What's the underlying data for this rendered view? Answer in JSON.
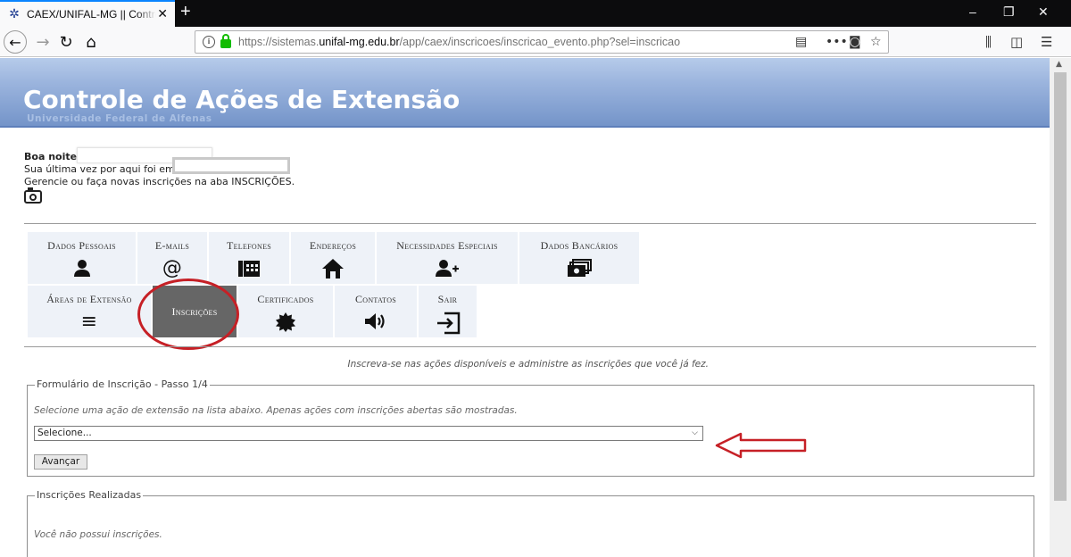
{
  "browser": {
    "tab_title": "CAEX/UNIFAL-MG || Controle de Ações de Extensão",
    "tab_close": "✕",
    "new_tab": "+",
    "url_prefix": "https://sistemas.",
    "url_domain": "unifal-mg.edu.br",
    "url_path": "/app/caex/inscricoes/inscricao_evento.php?sel=inscricao",
    "window_controls": [
      "–",
      "❐",
      "✕"
    ]
  },
  "header": {
    "title": "Controle de Ações de Extensão",
    "subtitle": "Universidade Federal de Alfenas"
  },
  "greeting": {
    "line1": "Boa noite",
    "line2": "Sua última vez por aqui foi em",
    "line3": "Gerencie ou faça novas inscrições na aba INSCRIÇÕES."
  },
  "menu": {
    "row1": [
      {
        "label": "Dados Pessoais",
        "icon": "👤"
      },
      {
        "label": "E-mails",
        "icon": "@"
      },
      {
        "label": "Telefones",
        "icon": "☎"
      },
      {
        "label": "Endereços",
        "icon": "⌂"
      },
      {
        "label": "Necessidades Especiais",
        "icon": "👤"
      },
      {
        "label": "Dados Bancários",
        "icon": "💵"
      }
    ],
    "row2": [
      {
        "label": "Áreas de Extensão",
        "icon": "≡"
      },
      {
        "label": "Inscrições",
        "icon": ""
      },
      {
        "label": "Certificados",
        "icon": "✹"
      },
      {
        "label": "Contatos",
        "icon": "🔊"
      },
      {
        "label": "Sair",
        "icon": "⇥"
      }
    ]
  },
  "intro_hint": "Inscreva-se nas ações disponíveis e administre as inscrições que você já fez.",
  "form": {
    "legend": "Formulário de Inscrição - Passo 1/4",
    "hint": "Selecione uma ação de extensão na lista abaixo. Apenas ações com inscrições abertas são mostradas.",
    "select_value": "Selecione...",
    "submit_label": "Avançar"
  },
  "registrations": {
    "legend": "Inscrições Realizadas",
    "empty_text": "Você não possui inscrições."
  },
  "colors": {
    "annotation_red": "#c62026",
    "active_tab": "#666666",
    "tile_bg": "#eef2f8"
  }
}
